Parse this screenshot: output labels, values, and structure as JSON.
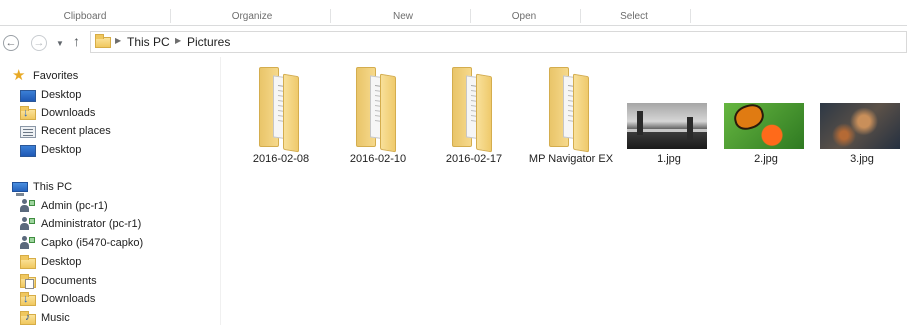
{
  "ribbon": {
    "groups": [
      "Clipboard",
      "Organize",
      "New",
      "Open",
      "Select"
    ]
  },
  "address": {
    "crumbs": [
      "This PC",
      "Pictures"
    ]
  },
  "nav": {
    "favorites_label": "Favorites",
    "favorites": [
      {
        "label": "Desktop",
        "icon": "desktop-icon"
      },
      {
        "label": "Downloads",
        "icon": "downloads-icon"
      },
      {
        "label": "Recent places",
        "icon": "recent-places-icon"
      },
      {
        "label": "Desktop",
        "icon": "desktop-icon"
      }
    ],
    "thispc_label": "This PC",
    "thispc": [
      {
        "label": "Admin (pc-r1)",
        "icon": "user-network-icon"
      },
      {
        "label": "Administrator (pc-r1)",
        "icon": "user-network-icon"
      },
      {
        "label": "Capko (i5470-capko)",
        "icon": "user-network-icon"
      },
      {
        "label": "Desktop",
        "icon": "desktop-folder-icon"
      },
      {
        "label": "Documents",
        "icon": "documents-icon"
      },
      {
        "label": "Downloads",
        "icon": "downloads-icon"
      },
      {
        "label": "Music",
        "icon": "music-icon"
      }
    ]
  },
  "files": [
    {
      "name": "2016-02-08",
      "kind": "folder"
    },
    {
      "name": "2016-02-10",
      "kind": "folder"
    },
    {
      "name": "2016-02-17",
      "kind": "folder"
    },
    {
      "name": "MP Navigator EX",
      "kind": "folder"
    },
    {
      "name": "1.jpg",
      "kind": "image"
    },
    {
      "name": "2.jpg",
      "kind": "image"
    },
    {
      "name": "3.jpg",
      "kind": "image"
    }
  ]
}
